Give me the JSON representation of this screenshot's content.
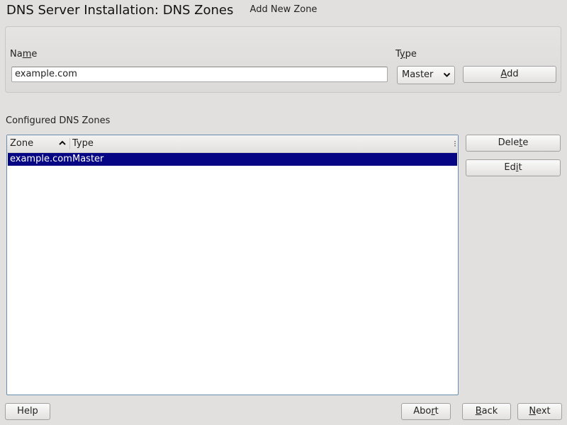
{
  "window": {
    "title": "DNS Server Installation: DNS Zones"
  },
  "add_zone": {
    "group_title": "Add New Zone",
    "name_label": {
      "pre": "Na",
      "key": "m",
      "post": "e"
    },
    "name_value": "example.com",
    "type_label": {
      "pre": "T",
      "key": "y",
      "post": "pe"
    },
    "type_value": "Master",
    "add_button": {
      "pre": "",
      "key": "A",
      "post": "dd"
    }
  },
  "zones": {
    "section_label": "Configured DNS Zones",
    "columns": {
      "zone": "Zone",
      "type": "Type"
    },
    "sort_icon": "chevron-up-icon",
    "rows": [
      {
        "zone": "example.com",
        "type": "Master",
        "selected": true
      }
    ],
    "selection_color": "#060685",
    "delete_button": {
      "pre": "Dele",
      "key": "t",
      "post": "e"
    },
    "edit_button": {
      "pre": "Ed",
      "key": "i",
      "post": "t"
    }
  },
  "footer": {
    "help": "Help",
    "abort": {
      "pre": "Abo",
      "key": "r",
      "post": "t"
    },
    "back": {
      "pre": "",
      "key": "B",
      "post": "ack"
    },
    "next": {
      "pre": "",
      "key": "N",
      "post": "ext"
    }
  }
}
